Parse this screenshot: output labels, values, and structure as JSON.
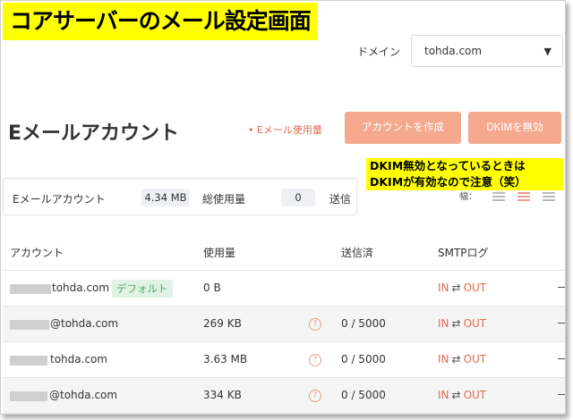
{
  "banner": "コアサーバーのメール設定画面",
  "domain": {
    "label": "ドメイン",
    "value": "tohda.com"
  },
  "title": "Eメールアカウント",
  "usage_link": "• Eメール使用量",
  "buttons": {
    "create": "アカウントを作成",
    "dkim": "DKIMを無効"
  },
  "note": {
    "line1": "DKIM無効となっているときは",
    "line2": "DKIMが有効なので注意（笑）"
  },
  "summary": {
    "label1": "Eメールアカウント",
    "size": "4.34 MB",
    "label2": "総使用量",
    "count": "0",
    "label3": "送信"
  },
  "width_label": "幅：",
  "table": {
    "headers": {
      "account": "アカウント",
      "usage": "使用量",
      "sent": "送信済",
      "smtp": "SMTPログ"
    },
    "rows": [
      {
        "account": "tohda.com",
        "badge": "デフォルト",
        "size": "0 B",
        "sent": "",
        "in": "IN",
        "arrow": "⇄",
        "out": "OUT"
      },
      {
        "account": "@tohda.com",
        "badge": "",
        "size": "269 KB",
        "sent": "0 / 5000",
        "in": "IN",
        "arrow": "⇄",
        "out": "OUT"
      },
      {
        "account": "tohda.com",
        "badge": "",
        "size": "3.63 MB",
        "sent": "0 / 5000",
        "in": "IN",
        "arrow": "⇄",
        "out": "OUT"
      },
      {
        "account": "@tohda.com",
        "badge": "",
        "size": "334 KB",
        "sent": "0 / 5000",
        "in": "IN",
        "arrow": "⇄",
        "out": "OUT"
      }
    ]
  },
  "colors": {
    "accent": "#e06c4f",
    "button": "#f4a98f",
    "highlight": "#ffff00",
    "badge": "#dff2e3"
  }
}
